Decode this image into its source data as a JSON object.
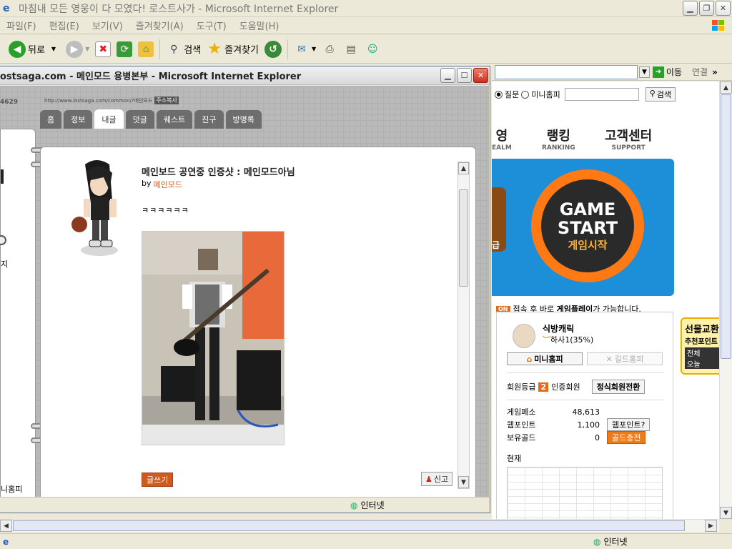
{
  "outer_window": {
    "title": "마침내 모든 영웅이 다 모였다! 로스트사가 - Microsoft Internet Explorer",
    "menu": [
      "파일(F)",
      "편집(E)",
      "보기(V)",
      "즐겨찾기(A)",
      "도구(T)",
      "도움말(H)"
    ],
    "toolbar": {
      "back": "뒤로",
      "search": "검색",
      "favorites": "즐겨찾기"
    },
    "address": {
      "go": "이동",
      "links": "연결",
      "links_arrow": "»"
    },
    "status": {
      "zone": "인터넷"
    }
  },
  "outer_page": {
    "search": {
      "opt1": "질문",
      "opt2": "미니홈피",
      "btn": "검색"
    },
    "nav": [
      {
        "ko": "영",
        "en": "EALM"
      },
      {
        "ko": "랭킹",
        "en": "RANKING"
      },
      {
        "ko": "고객센터",
        "en": "SUPPORT"
      }
    ],
    "banner": {
      "line1": "GAME",
      "line2": "START",
      "line3": "게임시작",
      "left_text": "급"
    },
    "notice": {
      "badge": "ON",
      "pre": "접속 후 바로 ",
      "bold": "게임플레이",
      "post": "가 가능합니다."
    },
    "user": {
      "name": "식방캐릭",
      "rank": "하사1(35%)",
      "minihome_btn": "미니홈피",
      "guild_btn": "길드홈피",
      "grade_label": "회원등급",
      "grade_num": "2",
      "grade_name": "인증회원",
      "upgrade_btn": "정식회원전환",
      "stats": [
        {
          "label": "게임페소",
          "value": "48,613",
          "btn": ""
        },
        {
          "label": "웹포인트",
          "value": "1,100",
          "btn": "웹포인트?"
        },
        {
          "label": "보유골드",
          "value": "0",
          "btn": "골드충전"
        }
      ],
      "current_label": "현재"
    },
    "gift": {
      "title": "선물교환",
      "sub": "추천포인트",
      "tabs": [
        "전체",
        "오늘"
      ]
    }
  },
  "popup": {
    "title": "ostsaga.com - 메인모드 용병본부 - Microsoft Internet Explorer",
    "counter": "4629",
    "url": "http://www.lostsaga.com/common/?메인모드",
    "copy_addr": "주소복사",
    "tabs": [
      "홈",
      "정보",
      "내글",
      "덧글",
      "퀘스트",
      "친구",
      "방명록"
    ],
    "active_tab": "내글",
    "left_labels": {
      "mid": "지",
      "bottom": "니홈피"
    },
    "post": {
      "title": "메인보드 공연중 인증샷 : 메인모드아님",
      "by": "by",
      "author": "메인모드",
      "body": "ㅋㅋㅋㅋㅋㅋ"
    },
    "write_btn": "글쓰기",
    "report_btn": "신고",
    "status": {
      "zone": "인터넷"
    }
  },
  "colors": {
    "accent": "#d05a1e",
    "banner_blue": "#1c8fd8",
    "gs_orange": "#ff7a14",
    "tab_grey": "#6d6d6d"
  }
}
